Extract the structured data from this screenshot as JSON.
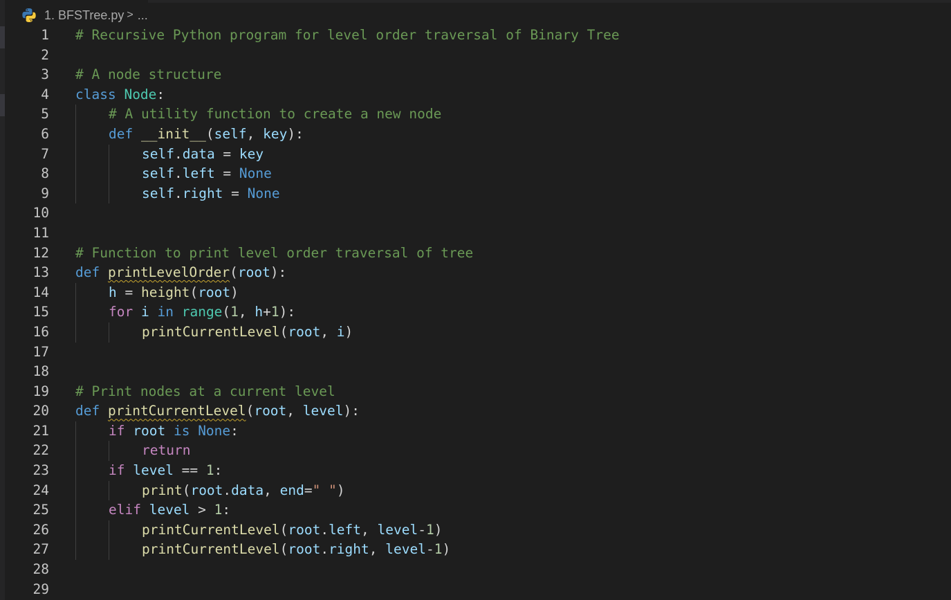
{
  "breadcrumb": {
    "file_label": "1. BFSTree.py",
    "separator": ">",
    "more": "...",
    "file_icon": "python-icon"
  },
  "colors": {
    "background": "#1e1e1e",
    "comment": "#6a9955",
    "keyword": "#569cd6",
    "control": "#c586c0",
    "class_name": "#4ec9b0",
    "function": "#dcdcaa",
    "variable": "#9cdcfe",
    "number": "#b5cea8",
    "string": "#ce9178",
    "line_number": "#c6c6c6"
  },
  "editor": {
    "lines": [
      {
        "n": "1",
        "indent": 0,
        "tokens": [
          {
            "t": "# Recursive Python program for level order traversal of Binary Tree",
            "c": "comment"
          }
        ]
      },
      {
        "n": "2",
        "indent": 0,
        "tokens": []
      },
      {
        "n": "3",
        "indent": 0,
        "tokens": [
          {
            "t": "# A node structure",
            "c": "comment"
          }
        ]
      },
      {
        "n": "4",
        "indent": 0,
        "tokens": [
          {
            "t": "class",
            "c": "keyword"
          },
          {
            "t": " ",
            "c": "plain"
          },
          {
            "t": "Node",
            "c": "class"
          },
          {
            "t": ":",
            "c": "plain"
          }
        ]
      },
      {
        "n": "5",
        "indent": 1,
        "tokens": [
          {
            "t": "# A utility function to create a new node",
            "c": "comment"
          }
        ]
      },
      {
        "n": "6",
        "indent": 1,
        "tokens": [
          {
            "t": "def",
            "c": "keyword"
          },
          {
            "t": " ",
            "c": "plain"
          },
          {
            "t": "__init__",
            "c": "func"
          },
          {
            "t": "(",
            "c": "plain"
          },
          {
            "t": "self",
            "c": "param"
          },
          {
            "t": ", ",
            "c": "plain"
          },
          {
            "t": "key",
            "c": "param"
          },
          {
            "t": "):",
            "c": "plain"
          }
        ]
      },
      {
        "n": "7",
        "indent": 2,
        "tokens": [
          {
            "t": "self",
            "c": "var"
          },
          {
            "t": ".",
            "c": "plain"
          },
          {
            "t": "data",
            "c": "var"
          },
          {
            "t": " = ",
            "c": "plain"
          },
          {
            "t": "key",
            "c": "var"
          }
        ]
      },
      {
        "n": "8",
        "indent": 2,
        "tokens": [
          {
            "t": "self",
            "c": "var"
          },
          {
            "t": ".",
            "c": "plain"
          },
          {
            "t": "left",
            "c": "var"
          },
          {
            "t": " = ",
            "c": "plain"
          },
          {
            "t": "None",
            "c": "const"
          }
        ]
      },
      {
        "n": "9",
        "indent": 2,
        "tokens": [
          {
            "t": "self",
            "c": "var"
          },
          {
            "t": ".",
            "c": "plain"
          },
          {
            "t": "right",
            "c": "var"
          },
          {
            "t": " = ",
            "c": "plain"
          },
          {
            "t": "None",
            "c": "const"
          }
        ]
      },
      {
        "n": "10",
        "indent": 0,
        "tokens": []
      },
      {
        "n": "11",
        "indent": 0,
        "tokens": []
      },
      {
        "n": "12",
        "indent": 0,
        "tokens": [
          {
            "t": "# Function to print level order traversal of tree",
            "c": "comment"
          }
        ]
      },
      {
        "n": "13",
        "indent": 0,
        "tokens": [
          {
            "t": "def",
            "c": "keyword"
          },
          {
            "t": " ",
            "c": "plain"
          },
          {
            "t": "printLevelOrder",
            "c": "func",
            "squiggle": true
          },
          {
            "t": "(",
            "c": "plain"
          },
          {
            "t": "root",
            "c": "param"
          },
          {
            "t": "):",
            "c": "plain"
          }
        ]
      },
      {
        "n": "14",
        "indent": 1,
        "tokens": [
          {
            "t": "h",
            "c": "var"
          },
          {
            "t": " = ",
            "c": "plain"
          },
          {
            "t": "height",
            "c": "func"
          },
          {
            "t": "(",
            "c": "plain"
          },
          {
            "t": "root",
            "c": "var"
          },
          {
            "t": ")",
            "c": "plain"
          }
        ]
      },
      {
        "n": "15",
        "indent": 1,
        "tokens": [
          {
            "t": "for",
            "c": "control"
          },
          {
            "t": " ",
            "c": "plain"
          },
          {
            "t": "i",
            "c": "var"
          },
          {
            "t": " ",
            "c": "plain"
          },
          {
            "t": "in",
            "c": "keyword"
          },
          {
            "t": " ",
            "c": "plain"
          },
          {
            "t": "range",
            "c": "builtin"
          },
          {
            "t": "(",
            "c": "plain"
          },
          {
            "t": "1",
            "c": "num"
          },
          {
            "t": ", ",
            "c": "plain"
          },
          {
            "t": "h",
            "c": "var"
          },
          {
            "t": "+",
            "c": "plain"
          },
          {
            "t": "1",
            "c": "num"
          },
          {
            "t": "):",
            "c": "plain"
          }
        ]
      },
      {
        "n": "16",
        "indent": 2,
        "tokens": [
          {
            "t": "printCurrentLevel",
            "c": "func"
          },
          {
            "t": "(",
            "c": "plain"
          },
          {
            "t": "root",
            "c": "var"
          },
          {
            "t": ", ",
            "c": "plain"
          },
          {
            "t": "i",
            "c": "var"
          },
          {
            "t": ")",
            "c": "plain"
          }
        ]
      },
      {
        "n": "17",
        "indent": 0,
        "tokens": []
      },
      {
        "n": "18",
        "indent": 0,
        "tokens": []
      },
      {
        "n": "19",
        "indent": 0,
        "tokens": [
          {
            "t": "# Print nodes at a current level",
            "c": "comment"
          }
        ]
      },
      {
        "n": "20",
        "indent": 0,
        "tokens": [
          {
            "t": "def",
            "c": "keyword"
          },
          {
            "t": " ",
            "c": "plain"
          },
          {
            "t": "printCurrentLevel",
            "c": "func",
            "squiggle": true
          },
          {
            "t": "(",
            "c": "plain"
          },
          {
            "t": "root",
            "c": "param"
          },
          {
            "t": ", ",
            "c": "plain"
          },
          {
            "t": "level",
            "c": "param"
          },
          {
            "t": "):",
            "c": "plain"
          }
        ]
      },
      {
        "n": "21",
        "indent": 1,
        "tokens": [
          {
            "t": "if",
            "c": "control"
          },
          {
            "t": " ",
            "c": "plain"
          },
          {
            "t": "root",
            "c": "var"
          },
          {
            "t": " ",
            "c": "plain"
          },
          {
            "t": "is",
            "c": "keyword"
          },
          {
            "t": " ",
            "c": "plain"
          },
          {
            "t": "None",
            "c": "const"
          },
          {
            "t": ":",
            "c": "plain"
          }
        ]
      },
      {
        "n": "22",
        "indent": 2,
        "tokens": [
          {
            "t": "return",
            "c": "control"
          }
        ]
      },
      {
        "n": "23",
        "indent": 1,
        "tokens": [
          {
            "t": "if",
            "c": "control"
          },
          {
            "t": " ",
            "c": "plain"
          },
          {
            "t": "level",
            "c": "var"
          },
          {
            "t": " == ",
            "c": "plain"
          },
          {
            "t": "1",
            "c": "num"
          },
          {
            "t": ":",
            "c": "plain"
          }
        ]
      },
      {
        "n": "24",
        "indent": 2,
        "tokens": [
          {
            "t": "print",
            "c": "func"
          },
          {
            "t": "(",
            "c": "plain"
          },
          {
            "t": "root",
            "c": "var"
          },
          {
            "t": ".",
            "c": "plain"
          },
          {
            "t": "data",
            "c": "var"
          },
          {
            "t": ", ",
            "c": "plain"
          },
          {
            "t": "end",
            "c": "param"
          },
          {
            "t": "=",
            "c": "plain"
          },
          {
            "t": "\" \"",
            "c": "str"
          },
          {
            "t": ")",
            "c": "plain"
          }
        ]
      },
      {
        "n": "25",
        "indent": 1,
        "tokens": [
          {
            "t": "elif",
            "c": "control"
          },
          {
            "t": " ",
            "c": "plain"
          },
          {
            "t": "level",
            "c": "var"
          },
          {
            "t": " > ",
            "c": "plain"
          },
          {
            "t": "1",
            "c": "num"
          },
          {
            "t": ":",
            "c": "plain"
          }
        ]
      },
      {
        "n": "26",
        "indent": 2,
        "tokens": [
          {
            "t": "printCurrentLevel",
            "c": "func"
          },
          {
            "t": "(",
            "c": "plain"
          },
          {
            "t": "root",
            "c": "var"
          },
          {
            "t": ".",
            "c": "plain"
          },
          {
            "t": "left",
            "c": "var"
          },
          {
            "t": ", ",
            "c": "plain"
          },
          {
            "t": "level",
            "c": "var"
          },
          {
            "t": "-",
            "c": "plain"
          },
          {
            "t": "1",
            "c": "num"
          },
          {
            "t": ")",
            "c": "plain"
          }
        ]
      },
      {
        "n": "27",
        "indent": 2,
        "tokens": [
          {
            "t": "printCurrentLevel",
            "c": "func"
          },
          {
            "t": "(",
            "c": "plain"
          },
          {
            "t": "root",
            "c": "var"
          },
          {
            "t": ".",
            "c": "plain"
          },
          {
            "t": "right",
            "c": "var"
          },
          {
            "t": ", ",
            "c": "plain"
          },
          {
            "t": "level",
            "c": "var"
          },
          {
            "t": "-",
            "c": "plain"
          },
          {
            "t": "1",
            "c": "num"
          },
          {
            "t": ")",
            "c": "plain"
          }
        ]
      },
      {
        "n": "28",
        "indent": 0,
        "tokens": []
      },
      {
        "n": "29",
        "indent": 0,
        "tokens": []
      }
    ]
  }
}
